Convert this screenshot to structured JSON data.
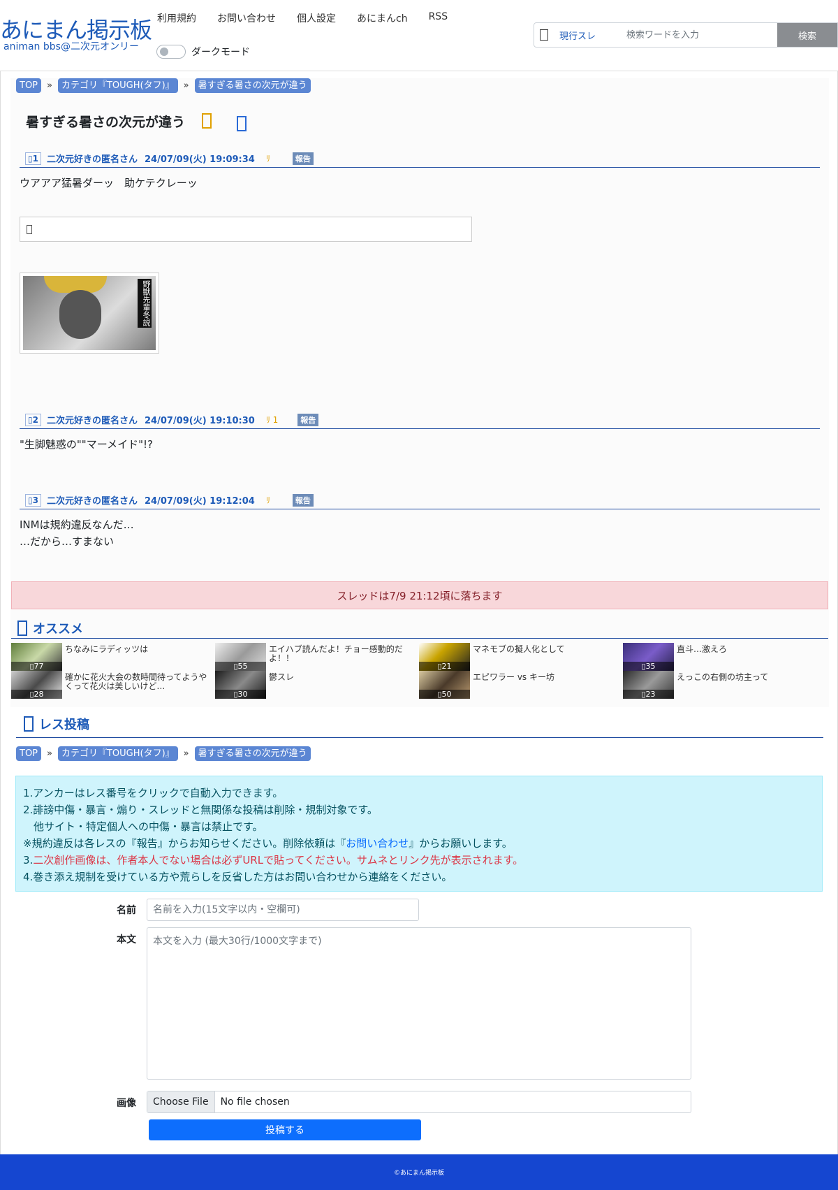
{
  "header": {
    "logo_main": "あにまん掲示板",
    "logo_sub": "animan bbs@二次元オンリー",
    "nav": [
      "利用規約",
      "お問い合わせ",
      "個人設定",
      "あにまんch",
      "RSS"
    ],
    "dark_mode_label": "ダークモード",
    "search": {
      "scope": "現行スレ",
      "placeholder": "検索ワードを入力",
      "button": "検索"
    }
  },
  "breadcrumb": {
    "top": "TOP",
    "sep": "»",
    "category": "カテゴリ『TOUGH(タフ)』",
    "thread": "暑すぎる暑さの次元が違う"
  },
  "thread": {
    "title": "暑すぎる暑さの次元が違う",
    "posts": [
      {
        "num": "1",
        "name": "二次元好きの匿名さん",
        "date": "24/07/09(火) 19:09:34",
        "reply": "",
        "report": "報告",
        "body": "ウアアア猛暑ダーッ　助ケテクレーッ"
      },
      {
        "num": "2",
        "name": "二次元好きの匿名さん",
        "date": "24/07/09(火) 19:10:30",
        "reply": "1",
        "report": "報告",
        "body": "\"生脚魅惑の\"\"マーメイド\"!?"
      },
      {
        "num": "3",
        "name": "二次元好きの匿名さん",
        "date": "24/07/09(火) 19:12:04",
        "reply": "",
        "report": "報告",
        "body": "INMは規約違反なんだ…\n…だから…すまない"
      }
    ],
    "thumb_caption": "野獣先輩冬説"
  },
  "fall_notice": "スレッドは7/9 21:12頃に落ちます",
  "recommend": {
    "title": "オススメ",
    "items": [
      {
        "title": "ちなみにラディッツは",
        "count": "77"
      },
      {
        "title": "エイハブ読んだよ！チョー感動的だよ！！",
        "count": "55"
      },
      {
        "title": "マネモブの擬人化として",
        "count": "21"
      },
      {
        "title": "直斗…激えろ",
        "count": "35"
      },
      {
        "title": "確かに花火大会の数時間待ってようやくって花火は美しいけど…",
        "count": "28"
      },
      {
        "title": "鬱スレ",
        "count": "30"
      },
      {
        "title": "エピワラー vs キー坊",
        "count": "50"
      },
      {
        "title": "えっこの右側の坊主って",
        "count": "23"
      }
    ]
  },
  "reply_form": {
    "title": "レス投稿",
    "notices": {
      "l1": "1.アンカーはレス番号をクリックで自動入力できます。",
      "l2": "2.誹謗中傷・暴言・煽り・スレッドと無関係な投稿は削除・規制対象です。",
      "l3": "　他サイト・特定個人への中傷・暴言は禁止です。",
      "l4a": "※規約違反は各レスの『報告』からお知らせください。削除依頼は『",
      "l4link": "お問い合わせ",
      "l4b": "』からお願いします。",
      "l5a": "3.",
      "l5b": "二次創作画像は、作者本人でない場合は必ずURLで貼ってください。サムネとリンク先が表示されます。",
      "l6": "4.巻き添え規制を受けている方や荒らしを反省した方はお問い合わせから連絡をください。"
    },
    "name_label": "名前",
    "name_placeholder": "名前を入力(15文字以内・空欄可)",
    "body_label": "本文",
    "body_placeholder": "本文を入力 (最大30行/1000文字まで)",
    "image_label": "画像",
    "file_button": "Choose File",
    "file_status": "No file chosen",
    "submit": "投稿する"
  },
  "footer": "©あにまん掲示板",
  "colors": {
    "accent": "#1e5bb8",
    "footer": "#1546d0",
    "alert_bg": "#f8d7da",
    "info_bg": "#cff4fc"
  }
}
